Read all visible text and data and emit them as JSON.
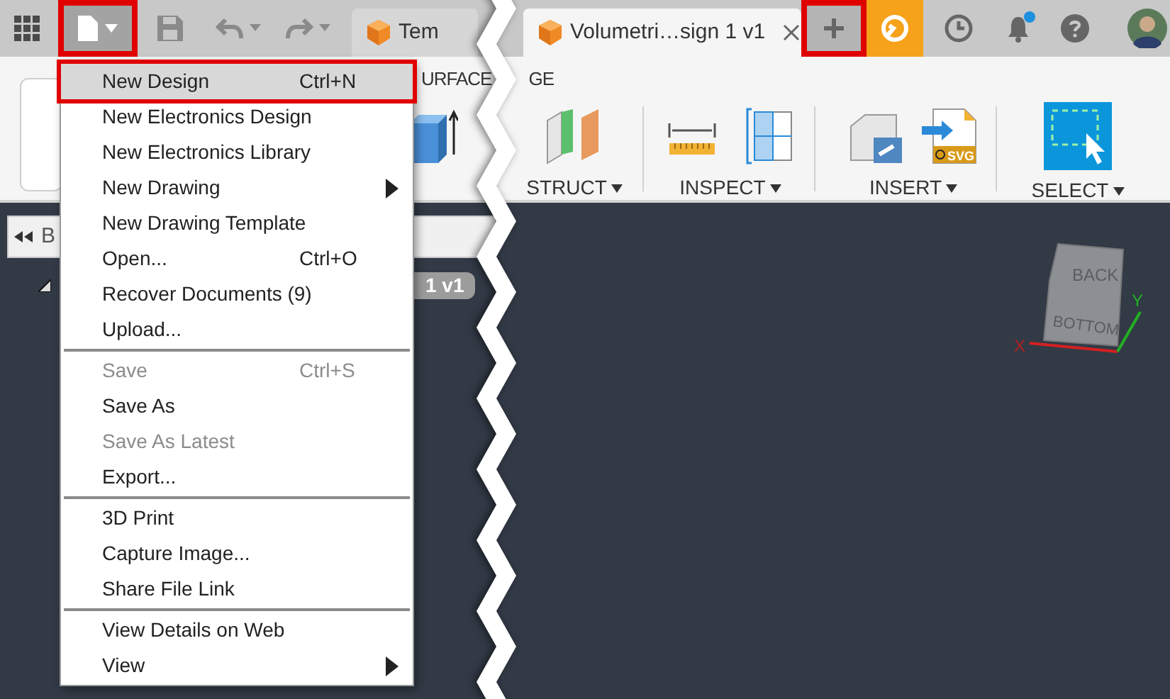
{
  "top_bar": {
    "file_button": {
      "highlighted": true
    },
    "tabs": [
      {
        "label": "Tem",
        "selected": false,
        "closable": false
      },
      {
        "label": "Volumetri…sign 1 v1",
        "selected": true,
        "closable": true
      }
    ],
    "new_tab_button": {
      "highlighted": true
    },
    "notification_badge": true
  },
  "ribbon": {
    "tabs": [
      {
        "label": "URFACE"
      },
      {
        "label": "GE"
      }
    ],
    "groups": [
      {
        "kind": "construct",
        "label": "STRUCT"
      },
      {
        "kind": "inspect",
        "label": "INSPECT"
      },
      {
        "kind": "insert",
        "label": "INSERT",
        "icon_text": "SVG"
      },
      {
        "kind": "select",
        "label": "SELECT"
      }
    ]
  },
  "browser": {
    "label": "B",
    "node_label": "1 v1"
  },
  "view_cube": {
    "faces": [
      "BACK",
      "BOTTOM"
    ],
    "axes": [
      "X",
      "Y"
    ]
  },
  "file_menu": {
    "items": [
      {
        "kind": "item",
        "label": "New Design",
        "shortcut": "Ctrl+N",
        "selected": true,
        "disabled": false,
        "submenu": false,
        "highlighted": true
      },
      {
        "kind": "item",
        "label": "New Electronics Design",
        "selected": false,
        "disabled": false,
        "submenu": false,
        "highlighted": false
      },
      {
        "kind": "item",
        "label": "New Electronics Library",
        "selected": false,
        "disabled": false,
        "submenu": false,
        "highlighted": false
      },
      {
        "kind": "item",
        "label": "New Drawing",
        "selected": false,
        "disabled": false,
        "submenu": true,
        "highlighted": false
      },
      {
        "kind": "item",
        "label": "New Drawing Template",
        "selected": false,
        "disabled": false,
        "submenu": false,
        "highlighted": false
      },
      {
        "kind": "item",
        "label": "Open...",
        "shortcut": "Ctrl+O",
        "selected": false,
        "disabled": false,
        "submenu": false,
        "highlighted": false
      },
      {
        "kind": "item",
        "label": "Recover Documents (9)",
        "selected": false,
        "disabled": false,
        "submenu": false,
        "highlighted": false
      },
      {
        "kind": "item",
        "label": "Upload...",
        "selected": false,
        "disabled": false,
        "submenu": false,
        "highlighted": false
      },
      {
        "kind": "separator"
      },
      {
        "kind": "item",
        "label": "Save",
        "shortcut": "Ctrl+S",
        "selected": false,
        "disabled": true,
        "submenu": false,
        "highlighted": false
      },
      {
        "kind": "item",
        "label": "Save As",
        "selected": false,
        "disabled": false,
        "submenu": false,
        "highlighted": false
      },
      {
        "kind": "item",
        "label": "Save As Latest",
        "selected": false,
        "disabled": true,
        "submenu": false,
        "highlighted": false
      },
      {
        "kind": "item",
        "label": "Export...",
        "selected": false,
        "disabled": false,
        "submenu": false,
        "highlighted": false
      },
      {
        "kind": "separator"
      },
      {
        "kind": "item",
        "label": "3D Print",
        "selected": false,
        "disabled": false,
        "submenu": false,
        "highlighted": false
      },
      {
        "kind": "item",
        "label": "Capture Image...",
        "selected": false,
        "disabled": false,
        "submenu": false,
        "highlighted": false
      },
      {
        "kind": "item",
        "label": "Share File Link",
        "selected": false,
        "disabled": false,
        "submenu": false,
        "highlighted": false
      },
      {
        "kind": "separator"
      },
      {
        "kind": "item",
        "label": "View Details on Web",
        "selected": false,
        "disabled": false,
        "submenu": false,
        "highlighted": false
      },
      {
        "kind": "item",
        "label": "View",
        "selected": false,
        "disabled": false,
        "submenu": true,
        "highlighted": false
      }
    ]
  }
}
